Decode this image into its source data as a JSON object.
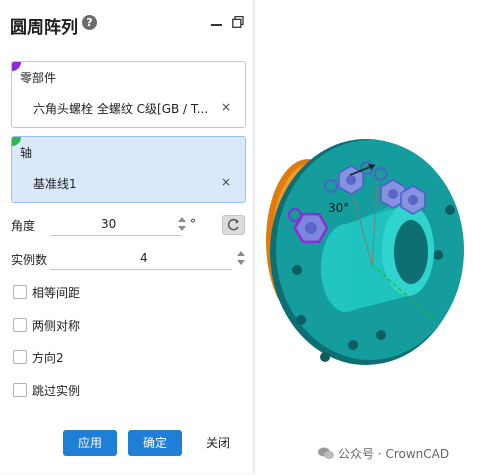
{
  "panel": {
    "title": "圆周阵列",
    "help_icon": "?"
  },
  "parts": {
    "label": "零部件",
    "value": "六角头螺栓 全螺纹 C级[GB / T...",
    "remove": "×",
    "accent": "#8e2ad6"
  },
  "axis": {
    "label": "轴",
    "value": "基准线1",
    "remove": "×",
    "accent": "#2db84d"
  },
  "angle": {
    "label": "角度",
    "value": "30",
    "unit": "°"
  },
  "count": {
    "label": "实例数",
    "value": "4"
  },
  "options": [
    {
      "label": "相等间距",
      "checked": false
    },
    {
      "label": "两侧对称",
      "checked": false
    },
    {
      "label": "方向2",
      "checked": false
    },
    {
      "label": "跳过实例",
      "checked": false
    }
  ],
  "buttons": {
    "apply": "应用",
    "ok": "确定",
    "close": "关闭"
  },
  "viewport": {
    "angle_annotation": "30°"
  },
  "watermark": "公众号 · CrownCAD",
  "colors": {
    "primary": "#1f7ed6",
    "flange": "#16a7a2",
    "flange_back": "#ef8a14",
    "bolt": "#6f7fd6",
    "selected_bolt": "#8e2ad6"
  }
}
